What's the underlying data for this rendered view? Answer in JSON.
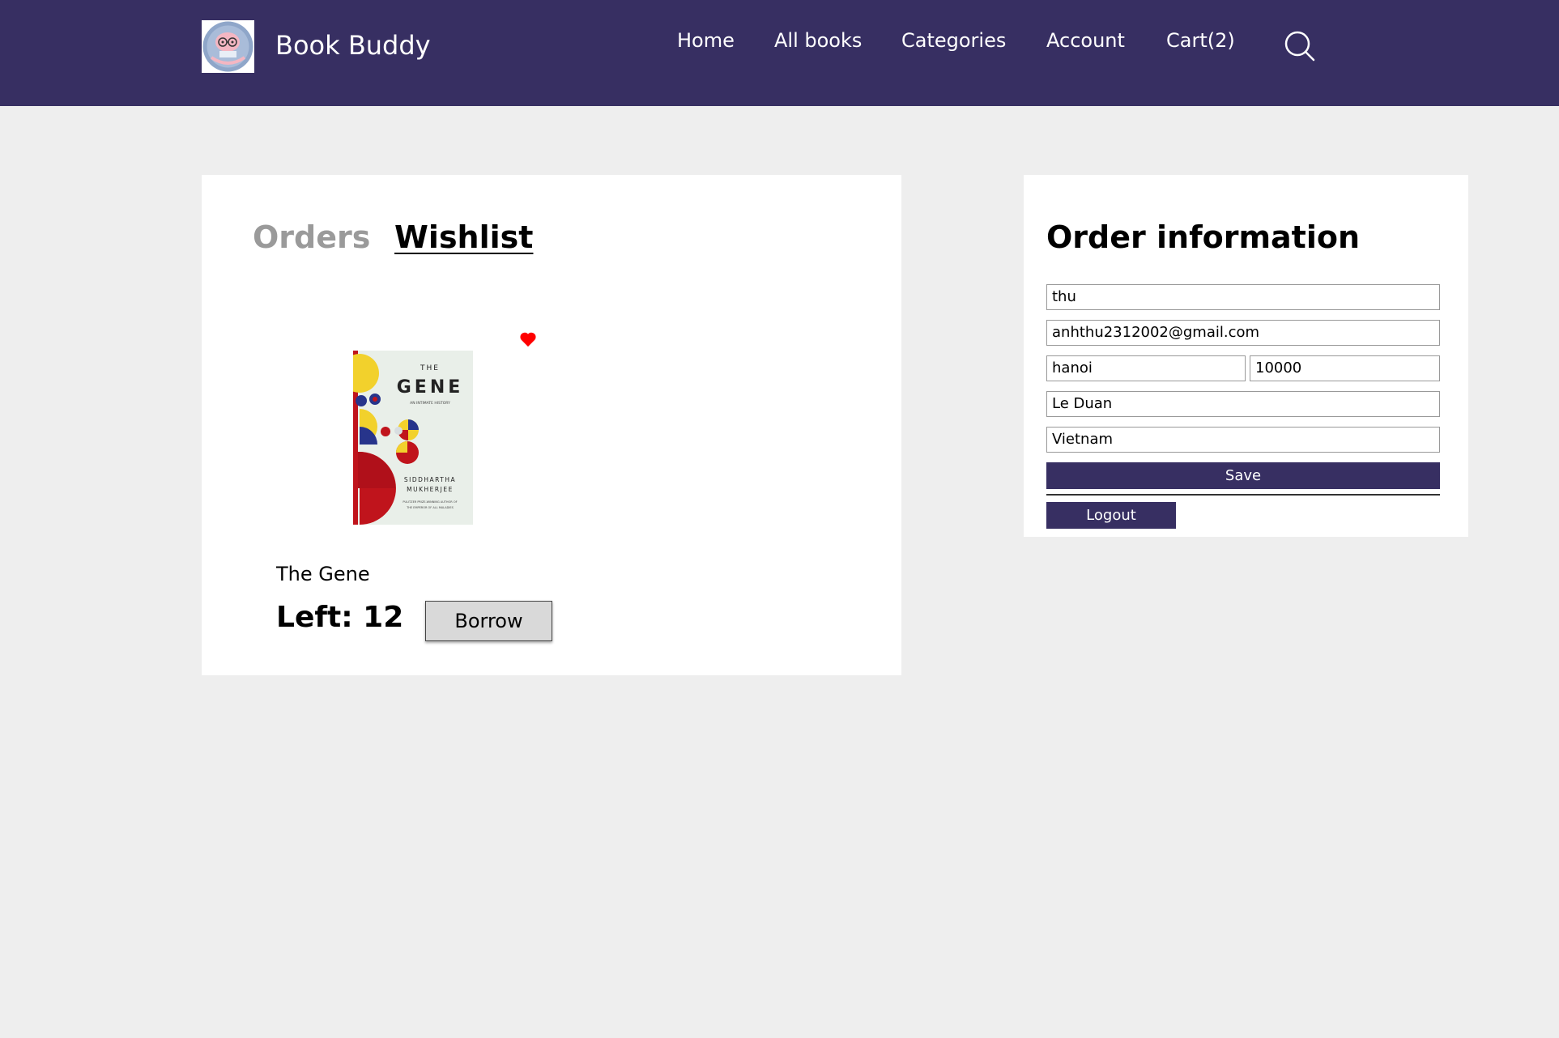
{
  "header": {
    "brand": "Book Buddy",
    "logo_text": "Book Buddy",
    "nav": [
      {
        "label": "Home"
      },
      {
        "label": "All books"
      },
      {
        "label": "Categories"
      },
      {
        "label": "Account"
      },
      {
        "label": "Cart(2)"
      }
    ],
    "search_icon": "search-icon",
    "background_color": "#372f62"
  },
  "tabs": {
    "orders": "Orders",
    "wishlist": "Wishlist",
    "active": "Wishlist"
  },
  "wishlist": {
    "items": [
      {
        "title": "The Gene",
        "left_text": "Left: 12",
        "borrow_label": "Borrow",
        "favorite_icon": "heart-icon",
        "favorite_color": "#ff0000",
        "cover": {
          "line1": "THE",
          "line2": "GENE",
          "line3": "AN INTIMATE HISTORY",
          "author1": "SIDDHARTHA",
          "author2": "MUKHERJEE",
          "tagline1": "PULITZER PRIZE-WINNING AUTHOR OF",
          "tagline2": "THE EMPEROR OF ALL MALADIES"
        }
      }
    ]
  },
  "order_info": {
    "title": "Order information",
    "fields": {
      "name": "thu",
      "email": "anhthu2312002@gmail.com",
      "city": "hanoi",
      "postal_code": "10000",
      "street": "Le Duan",
      "country": "Vietnam"
    },
    "save_label": "Save",
    "logout_label": "Logout",
    "button_color": "#372f62"
  }
}
